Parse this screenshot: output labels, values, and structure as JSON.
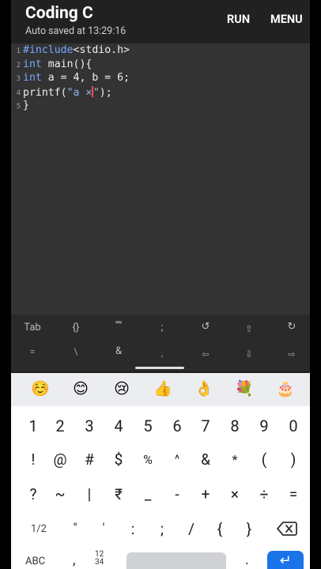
{
  "header": {
    "title": "Coding C",
    "subtitle": "Auto saved at 13:29:16",
    "run_label": "RUN",
    "menu_label": "MENU"
  },
  "editor": {
    "line_numbers": [
      "1",
      "2",
      "3",
      "4",
      "5"
    ],
    "lines": [
      {
        "kw": "#include",
        "rest": "<stdio.h>"
      },
      {
        "kw": "int",
        "rest": " main(){"
      },
      {
        "kw": "int",
        "rest": " a = 4, b = 6;"
      },
      {
        "pre": "printf(",
        "str": "\"a ×",
        "cursor_after": "\"",
        "post": ");"
      },
      {
        "rest": "}"
      }
    ]
  },
  "extra_keys": {
    "row1": [
      "Tab",
      "{}",
      "“”",
      ";",
      "↺",
      "⇧",
      "↻"
    ],
    "row2": [
      "=",
      "\\",
      "&",
      ",",
      "⇦",
      "⇩",
      "⇨"
    ]
  },
  "keyboard": {
    "emojis": [
      "☺️",
      "😊",
      "😢",
      "👍",
      "👌",
      "💐",
      "🎂"
    ],
    "numbers": [
      "1",
      "2",
      "3",
      "4",
      "5",
      "6",
      "7",
      "8",
      "9",
      "0"
    ],
    "symbols_row1": [
      "!",
      "@",
      "#",
      "$",
      "%",
      "^",
      "&",
      "*",
      "(",
      ")"
    ],
    "symbols_row2": [
      "?",
      "~",
      "|",
      "₹",
      "_",
      "-",
      "+",
      "×",
      "÷",
      "="
    ],
    "symbols_row3": [
      "1/2",
      "\"",
      "'",
      ":",
      ";",
      "/",
      "{",
      "}"
    ],
    "abc_label": "ABC",
    "comma": ",",
    "fraction_label_top": "12",
    "fraction_label_bottom": "34",
    "period": ".",
    "enter_symbol": "↵"
  }
}
